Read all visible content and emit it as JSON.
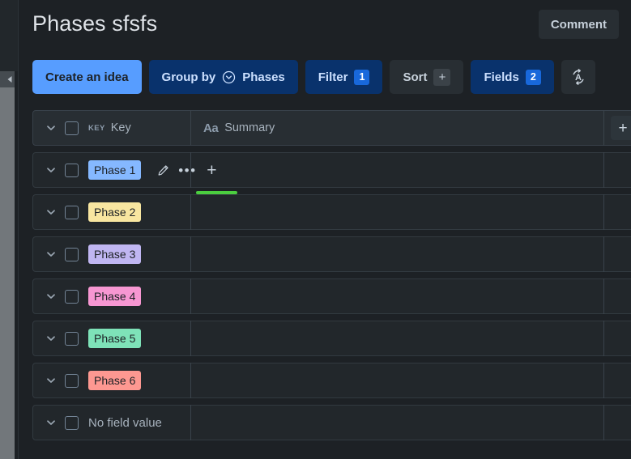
{
  "header": {
    "title": "Phases sfsfs",
    "comment_label": "Comment"
  },
  "toolbar": {
    "create_label": "Create an idea",
    "group_by_label": "Group by",
    "group_by_value": "Phases",
    "filter_label": "Filter",
    "filter_count": "1",
    "sort_label": "Sort",
    "sort_add": "+",
    "fields_label": "Fields",
    "fields_count": "2",
    "translate_icon": "translate-icon"
  },
  "table": {
    "header": {
      "key_icon_text": "KEY",
      "key_label": "Key",
      "summary_icon_text": "Aa",
      "summary_label": "Summary",
      "add_column_label": "+"
    },
    "rows": [
      {
        "label": "Phase 1",
        "color": "#85b8ff",
        "chip": true,
        "actions": true,
        "underline": true,
        "underline_color": "#4bce3f"
      },
      {
        "label": "Phase 2",
        "color": "#f8e6a0",
        "chip": true,
        "actions": false,
        "underline": false
      },
      {
        "label": "Phase 3",
        "color": "#c0b6f2",
        "chip": true,
        "actions": false,
        "underline": false
      },
      {
        "label": "Phase 4",
        "color": "#f797d2",
        "chip": true,
        "actions": false,
        "underline": false
      },
      {
        "label": "Phase 5",
        "color": "#7ee2b8",
        "chip": true,
        "actions": false,
        "underline": false
      },
      {
        "label": "Phase 6",
        "color": "#fd9891",
        "chip": true,
        "actions": false,
        "underline": false
      },
      {
        "label": "No field value",
        "color": "",
        "chip": false,
        "actions": false,
        "underline": false
      }
    ],
    "row_actions": {
      "edit_icon": "pencil-icon",
      "more_label": "•••",
      "add_label": "+"
    }
  },
  "colors": {
    "page_bg": "#1d2125",
    "row_bg": "#22272b",
    "accent_blue": "#579dff",
    "badge_blue": "#1868db",
    "button_blue_bg": "#09326c"
  }
}
